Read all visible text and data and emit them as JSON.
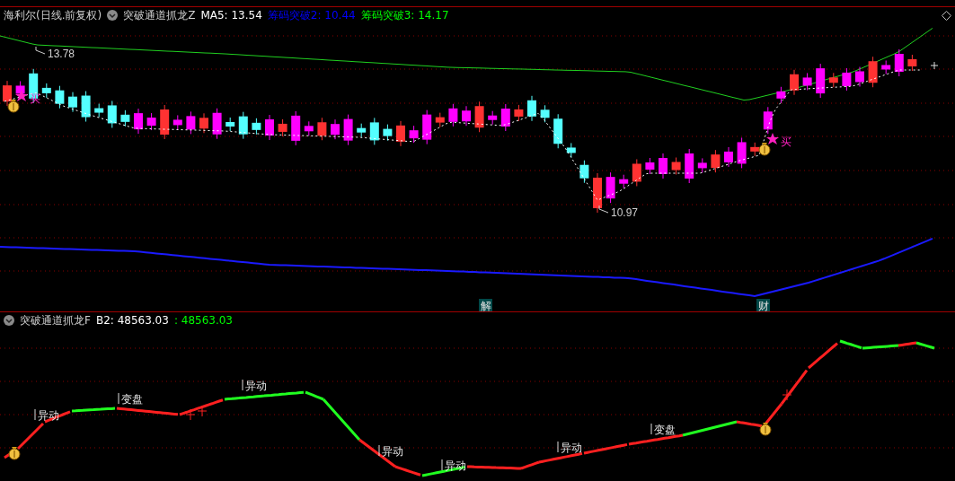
{
  "main_panel": {
    "legend": {
      "stock": "海利尔(日线.前复权)",
      "indicator": "突破通道抓龙Z",
      "items": [
        {
          "text": "MA5: 13.54",
          "color": "#ffffff"
        },
        {
          "text": "筹码突破2: 10.44",
          "color": "#0000ff"
        },
        {
          "text": "筹码突破3: 14.17",
          "color": "#00ff00"
        }
      ]
    },
    "price_labels": [
      {
        "text": "13.78"
      },
      {
        "text": "10.97"
      }
    ],
    "buy_signals": [
      {
        "text": "买"
      },
      {
        "text": "买"
      }
    ],
    "event_markers": [
      {
        "text": "解"
      },
      {
        "text": "财"
      }
    ]
  },
  "sub_panel": {
    "legend": {
      "indicator": "突破通道抓龙F",
      "items": [
        {
          "text": "B2: 48563.03",
          "color": "#ffffff"
        },
        {
          "text": ": 48563.03",
          "color": "#00ff00"
        }
      ]
    },
    "labels": [
      {
        "text": "异动"
      },
      {
        "text": "变盘"
      },
      {
        "text": "异动"
      },
      {
        "text": "异动"
      },
      {
        "text": "异动"
      },
      {
        "text": "异动"
      },
      {
        "text": "变盘"
      }
    ]
  }
}
